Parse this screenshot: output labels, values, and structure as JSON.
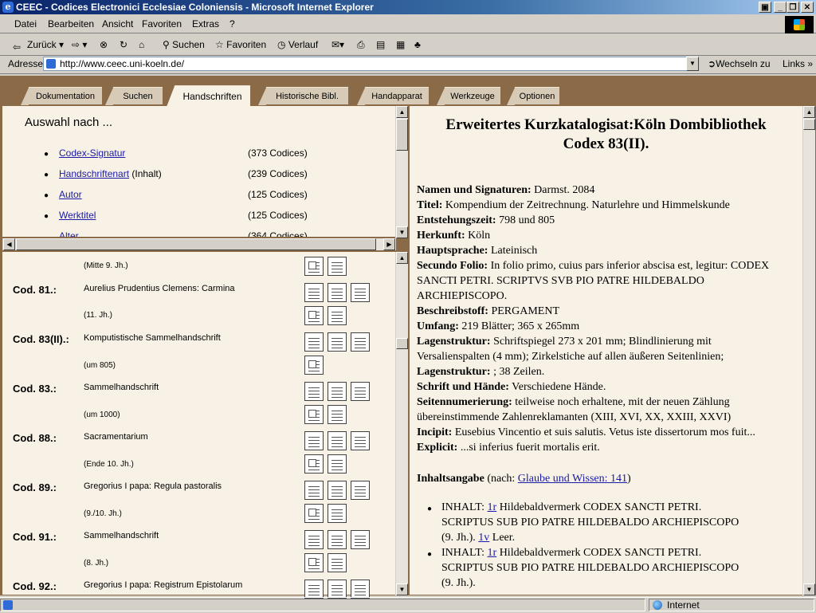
{
  "window": {
    "title": "CEEC - Codices Electronici Ecclesiae Coloniensis - Microsoft Internet Explorer"
  },
  "menu": [
    "Datei",
    "Bearbeiten",
    "Ansicht",
    "Favoriten",
    "Extras",
    "?"
  ],
  "toolbar": {
    "back": "Zurück",
    "search": "Suchen",
    "favorites": "Favoriten",
    "history": "Verlauf"
  },
  "address": {
    "label": "Adresse",
    "url": "http://www.ceec.uni-koeln.de/",
    "go": "Wechseln zu",
    "links": "Links"
  },
  "tabs": [
    "Dokumentation",
    "Suchen",
    "Handschriften",
    "Historische Bibl.",
    "Handapparat",
    "Werkzeuge",
    "Optionen"
  ],
  "left_top": {
    "title": "Auswahl nach ...",
    "items": [
      {
        "link": "Codex-Signatur",
        "extra": "",
        "count": "(373 Codices)"
      },
      {
        "link": "Handschriftenart",
        "extra": " (Inhalt)",
        "count": "(239 Codices)"
      },
      {
        "link": "Autor",
        "extra": "",
        "count": "(125 Codices)"
      },
      {
        "link": "Werktitel",
        "extra": "",
        "count": "(125 Codices)"
      },
      {
        "link": "Alter",
        "extra": "",
        "count": "(364 Codices)"
      }
    ]
  },
  "codex_list": {
    "first_date": "(Mitte 9. Jh.)",
    "entries": [
      {
        "sig": "Cod. 81.:",
        "title": "Aurelius Prudentius Clemens: Carmina",
        "date": "(11. Jh.)"
      },
      {
        "sig": "Cod. 83(II).:",
        "title": "Komputistische Sammelhandschrift",
        "date": "(um 805)"
      },
      {
        "sig": "Cod. 83.:",
        "title": "Sammelhandschrift",
        "date": "(um 1000)"
      },
      {
        "sig": "Cod. 88.:",
        "title": "Sacramentarium",
        "date": "(Ende 10. Jh.)"
      },
      {
        "sig": "Cod. 89.:",
        "title": "Gregorius I papa: Regula pastoralis",
        "date": "(9./10. Jh.)"
      },
      {
        "sig": "Cod. 91.:",
        "title": "Sammelhandschrift",
        "date": "(8. Jh.)"
      },
      {
        "sig": "Cod. 92.:",
        "title": "Gregorius I papa: Registrum Epistolarum",
        "date": ""
      }
    ]
  },
  "detail": {
    "title_line1": "Erweitertes Kurzkatalogisat:Köln Dombibliothek",
    "title_line2": "Codex 83(II).",
    "fields": [
      {
        "label": "Namen und Signaturen:",
        "value": " Darmst. 2084"
      },
      {
        "label": "Titel:",
        "value": " Kompendium der Zeitrechnung. Naturlehre und Himmelskunde"
      },
      {
        "label": "Entstehungszeit:",
        "value": " 798 und 805"
      },
      {
        "label": "Herkunft:",
        "value": " Köln"
      },
      {
        "label": "Hauptsprache:",
        "value": " Lateinisch"
      },
      {
        "label": "Secundo Folio:",
        "value": " In folio primo, cuius pars inferior abscisa est, legitur: CODEX"
      },
      {
        "label": "",
        "value": "SANCTI PETRI. SCRIPTVS SVB PIO PATRE HILDEBALDO"
      },
      {
        "label": "",
        "value": "ARCHIEPISCOPO."
      },
      {
        "label": "Beschreibstoff:",
        "value": " PERGAMENT"
      },
      {
        "label": "Umfang:",
        "value": " 219 Blätter; 365 x 265mm"
      },
      {
        "label": "Lagenstruktur:",
        "value": " Schriftspiegel 273 x 201 mm; Blindlinierung mit"
      },
      {
        "label": "",
        "value": "Versalienspalten (4 mm); Zirkelstiche auf allen äußeren Seitenlinien;"
      },
      {
        "label": "Lagenstruktur:",
        "value": " ; 38 Zeilen."
      },
      {
        "label": "Schrift und Hände:",
        "value": " Verschiedene Hände."
      },
      {
        "label": "Seitennumerierung:",
        "value": " teilweise noch erhaltene, mit der neuen Zählung"
      },
      {
        "label": "",
        "value": "übereinstimmende Zahlenreklamanten (XIII, XVI, XX, XXIII, XXVI)"
      },
      {
        "label": "Incipit:",
        "value": " Eusebius Vincentio et suis salutis. Vetus iste dissertorum mos fuit..."
      },
      {
        "label": "Explicit:",
        "value": " ...si inferius fuerit mortalis erit."
      }
    ],
    "contents_label": "Inhaltsangabe",
    "contents_prefix": " (nach: ",
    "contents_link": "Glaube und Wissen: 141",
    "contents_suffix": ")",
    "contents": [
      {
        "pre": "INHALT: ",
        "f1": "1r",
        "t1": " Hildebaldvermerk CODEX SANCTI PETRI.",
        "l2": "SCRIPTUS SUB PIO PATRE HILDEBALDO ARCHIEPISCOPO",
        "l3pre": "(9. Jh.). ",
        "f2": "1v",
        "l3post": " Leer."
      },
      {
        "pre": "INHALT: ",
        "f1": "1r",
        "t1": " Hildebaldvermerk CODEX SANCTI PETRI.",
        "l2": "SCRIPTUS SUB PIO PATRE HILDEBALDO ARCHIEPISCOPO",
        "l3pre": "(9. Jh.).",
        "f2": "",
        "l3post": ""
      }
    ]
  },
  "status": {
    "zone": "Internet"
  }
}
